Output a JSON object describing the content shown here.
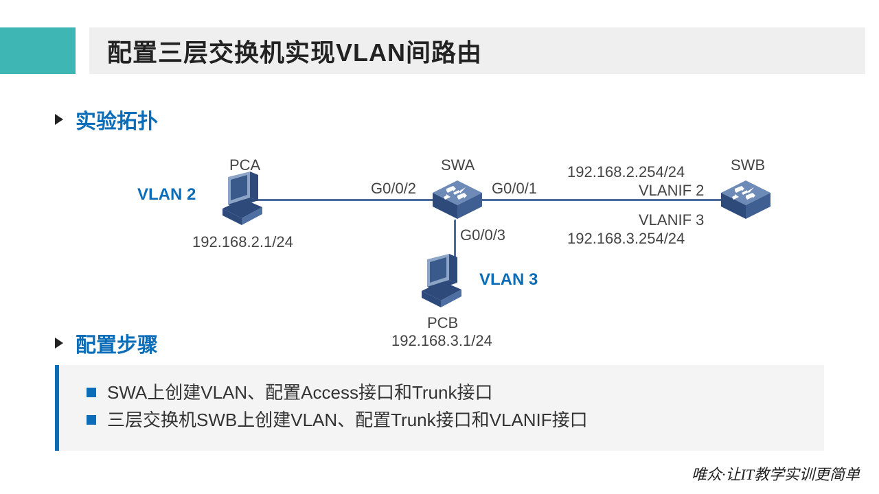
{
  "title": "配置三层交换机实现VLAN间路由",
  "sections": {
    "topology": "实验拓扑",
    "steps": "配置步骤"
  },
  "diagram": {
    "vlan2": "VLAN 2",
    "vlan3": "VLAN 3",
    "pca": {
      "name": "PCA",
      "ip": "192.168.2.1/24"
    },
    "pcb": {
      "name": "PCB",
      "ip": "192.168.3.1/24"
    },
    "swa": {
      "name": "SWA",
      "ports": {
        "g1": "G0/0/1",
        "g2": "G0/0/2",
        "g3": "G0/0/3"
      }
    },
    "swb": {
      "name": "SWB",
      "vlanif2": {
        "label": "VLANIF 2",
        "ip": "192.168.2.254/24"
      },
      "vlanif3": {
        "label": "VLANIF 3",
        "ip": "192.168.3.254/24"
      }
    }
  },
  "steps": [
    "SWA上创建VLAN、配置Access接口和Trunk接口",
    "三层交换机SWB上创建VLAN、配置Trunk接口和VLANIF接口"
  ],
  "footer": "唯众·让IT教学实训更简单"
}
